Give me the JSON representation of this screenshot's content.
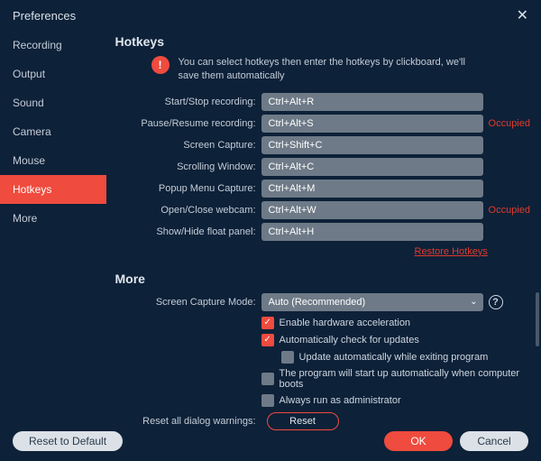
{
  "title": "Preferences",
  "sidebar": {
    "items": [
      {
        "label": "Recording"
      },
      {
        "label": "Output"
      },
      {
        "label": "Sound"
      },
      {
        "label": "Camera"
      },
      {
        "label": "Mouse"
      },
      {
        "label": "Hotkeys"
      },
      {
        "label": "More"
      }
    ]
  },
  "sections": {
    "hotkeys": {
      "title": "Hotkeys",
      "notice": "You can select hotkeys then enter the hotkeys by clickboard, we'll save them automatically",
      "occupied_label": "Occupied",
      "restore_label": "Restore Hotkeys",
      "rows": [
        {
          "label": "Start/Stop recording:",
          "value": "Ctrl+Alt+R",
          "occupied": false
        },
        {
          "label": "Pause/Resume recording:",
          "value": "Ctrl+Alt+S",
          "occupied": true
        },
        {
          "label": "Screen Capture:",
          "value": "Ctrl+Shift+C",
          "occupied": false
        },
        {
          "label": "Scrolling Window:",
          "value": "Ctrl+Alt+C",
          "occupied": false
        },
        {
          "label": "Popup Menu Capture:",
          "value": "Ctrl+Alt+M",
          "occupied": false
        },
        {
          "label": "Open/Close webcam:",
          "value": "Ctrl+Alt+W",
          "occupied": true
        },
        {
          "label": "Show/Hide float panel:",
          "value": "Ctrl+Alt+H",
          "occupied": false
        }
      ]
    },
    "more": {
      "title": "More",
      "mode_label": "Screen Capture Mode:",
      "mode_value": "Auto (Recommended)",
      "cb": [
        {
          "label": "Enable hardware acceleration",
          "checked": true,
          "indent": false
        },
        {
          "label": "Automatically check for updates",
          "checked": true,
          "indent": false
        },
        {
          "label": "Update automatically while exiting program",
          "checked": false,
          "indent": true
        },
        {
          "label": "The program will start up automatically when computer boots",
          "checked": false,
          "indent": false
        },
        {
          "label": "Always run as administrator",
          "checked": false,
          "indent": false
        }
      ],
      "reset_label": "Reset all dialog warnings:",
      "reset_btn": "Reset"
    }
  },
  "footer": {
    "reset_default": "Reset to Default",
    "ok": "OK",
    "cancel": "Cancel"
  }
}
